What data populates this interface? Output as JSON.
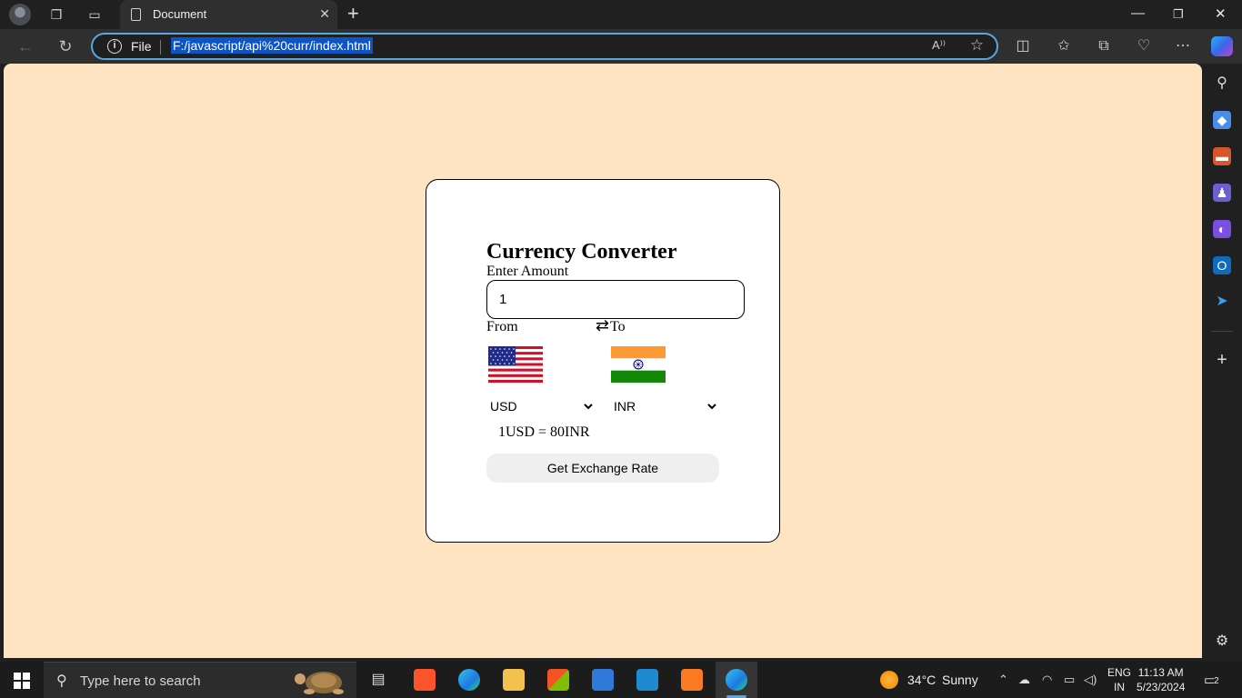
{
  "browser": {
    "tab_title": "Document",
    "address_prefix": "File",
    "url": "F:/javascript/api%20curr/index.html"
  },
  "page": {
    "heading": "Currency Converter",
    "amount_label": "Enter Amount",
    "amount_value": "1",
    "from_label": "From",
    "to_label": "To",
    "from_currency": "USD",
    "to_currency": "INR",
    "rate_text": "1USD = 80INR",
    "button_label": "Get Exchange Rate"
  },
  "taskbar": {
    "search_placeholder": "Type here to search",
    "temperature": "34°C",
    "weather": "Sunny",
    "language_top": "ENG",
    "language_bottom": "IN",
    "time": "11:13 AM",
    "date": "5/23/2024",
    "notification_count": "2"
  }
}
